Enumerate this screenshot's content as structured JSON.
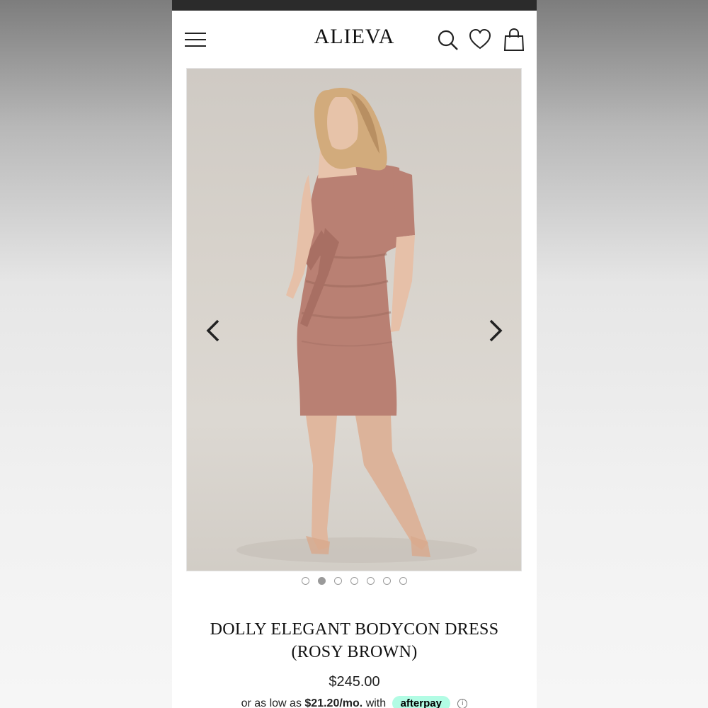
{
  "header": {
    "logo": "ALIEVA"
  },
  "gallery": {
    "slide_count": 7,
    "active_slide": 2
  },
  "product": {
    "title": "DOLLY ELEGANT BODYCON DRESS (ROSY BROWN)",
    "price": "$245.00",
    "installment_prefix": "or as low as",
    "installment_amount": "$21.20/mo.",
    "installment_with": "with",
    "afterpay_label": "afterpay",
    "info_glyph": "i"
  },
  "icons": {
    "menu": "hamburger-icon",
    "search": "search-icon",
    "wishlist": "heart-icon",
    "cart": "shopping-bag-icon",
    "prev": "chevron-left-icon",
    "next": "chevron-right-icon"
  },
  "colors": {
    "status_bar": "#2b2b2b",
    "dress": "#b98073",
    "afterpay_badge": "#b2fce4"
  }
}
